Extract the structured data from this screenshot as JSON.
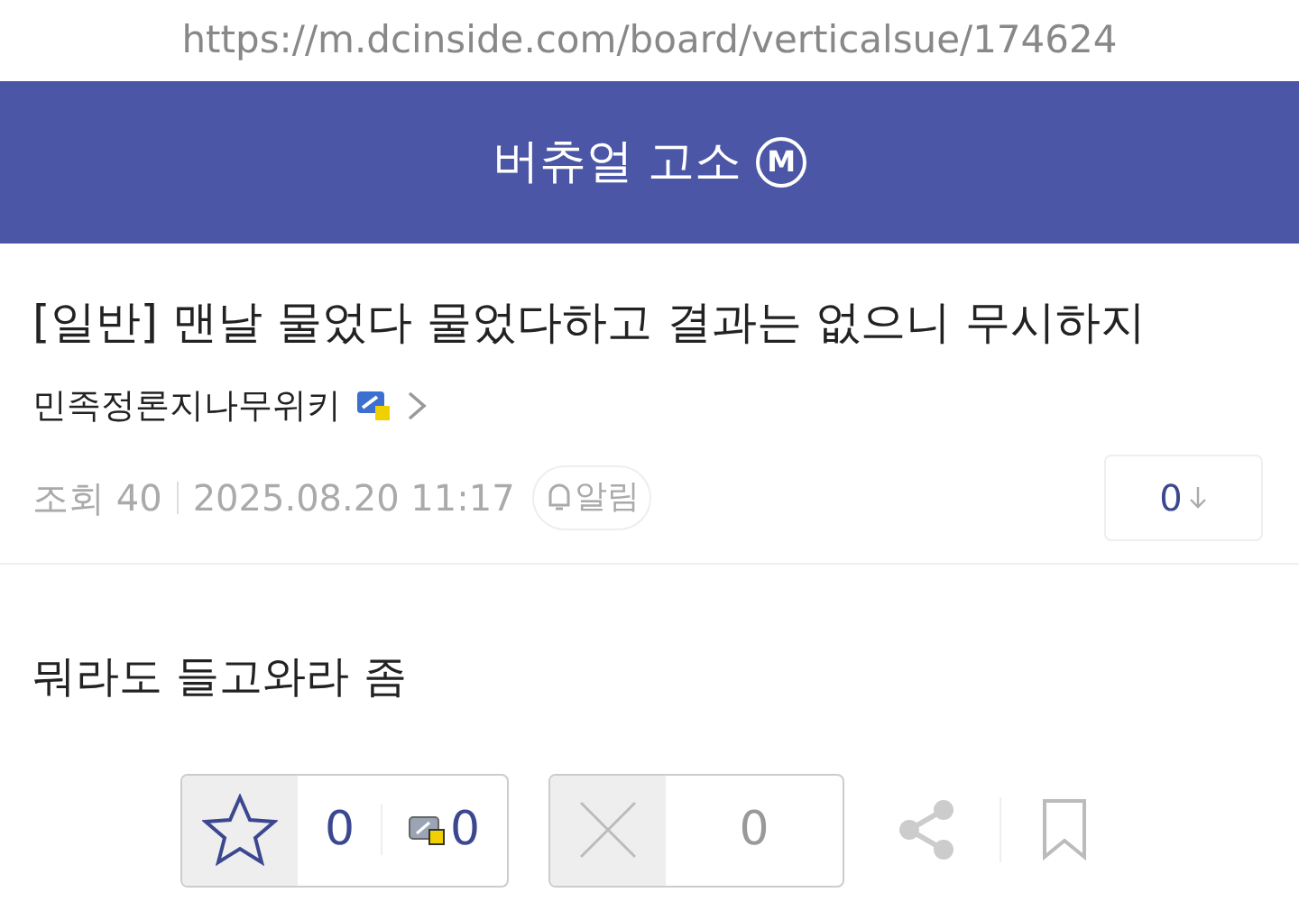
{
  "address_bar": {
    "url": "https://m.dcinside.com/board/verticalsue/174624"
  },
  "header": {
    "title": "버츄얼 고소",
    "badge": "M"
  },
  "post": {
    "title": "[일반] 맨날 물었다 물었다하고 결과는 없으니 무시하지",
    "author": "민족정론지나무위키",
    "views": "조회 40",
    "date": "2025.08.20 11:17",
    "alarm": "알림",
    "comments": "0",
    "body": "뭐라도 들고와라 좀"
  },
  "actions": {
    "upvotes": "0",
    "fixed_upvotes": "0",
    "downvotes": "0"
  }
}
